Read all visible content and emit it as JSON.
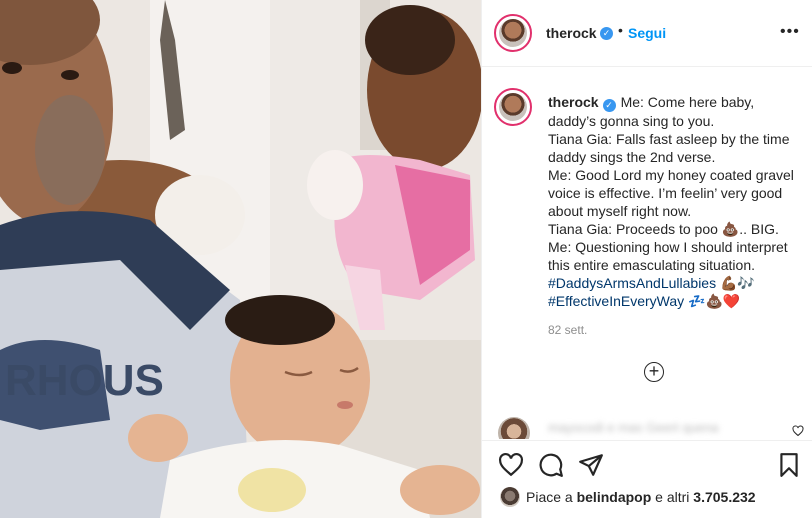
{
  "post": {
    "username": "therock",
    "follow_label": "Segui",
    "separator": "•",
    "more_label": "•••"
  },
  "caption": {
    "username": "therock",
    "lines": [
      "Me: Come here baby,",
      "daddy’s gonna sing to you.",
      "Tiana Gia: Falls fast asleep by the time",
      "daddy sings the 2nd verse.",
      "Me: Good Lord my honey coated gravel",
      "voice is effective. I’m feelin’ very good",
      "about myself right now.",
      "Tiana Gia: Proceeds to poo 💩.. BIG.",
      "Me: Questioning how I should interpret",
      "this entire emasculating situation."
    ],
    "hashtag_1": "#DaddysArmsAndLullabies",
    "hashtag_1_emoji": "💪🏾🎶",
    "hashtag_2": "#EffectiveInEveryWay",
    "hashtag_2_emoji": "💤💩❤️",
    "timestamp": "82 sett."
  },
  "load_more": {
    "label": "+"
  },
  "comment": {
    "text": "mayocodi e mas Geert quena"
  },
  "likes": {
    "prefix": "Piace a",
    "user": "belindapop",
    "connector": "e altri",
    "count": "3.705.232"
  },
  "icons": {
    "verified": "verified-badge-icon",
    "like": "heart-icon",
    "comment": "comment-icon",
    "share": "paper-plane-icon",
    "save": "bookmark-icon",
    "load_more": "plus-circle-icon",
    "comment_like": "small-heart-icon"
  },
  "colors": {
    "link_blue": "#0095f6",
    "hashtag_blue": "#00376b",
    "verified_blue": "#3897f0",
    "muted_text": "#8e8e8e",
    "story_ring": "#e1306c"
  }
}
